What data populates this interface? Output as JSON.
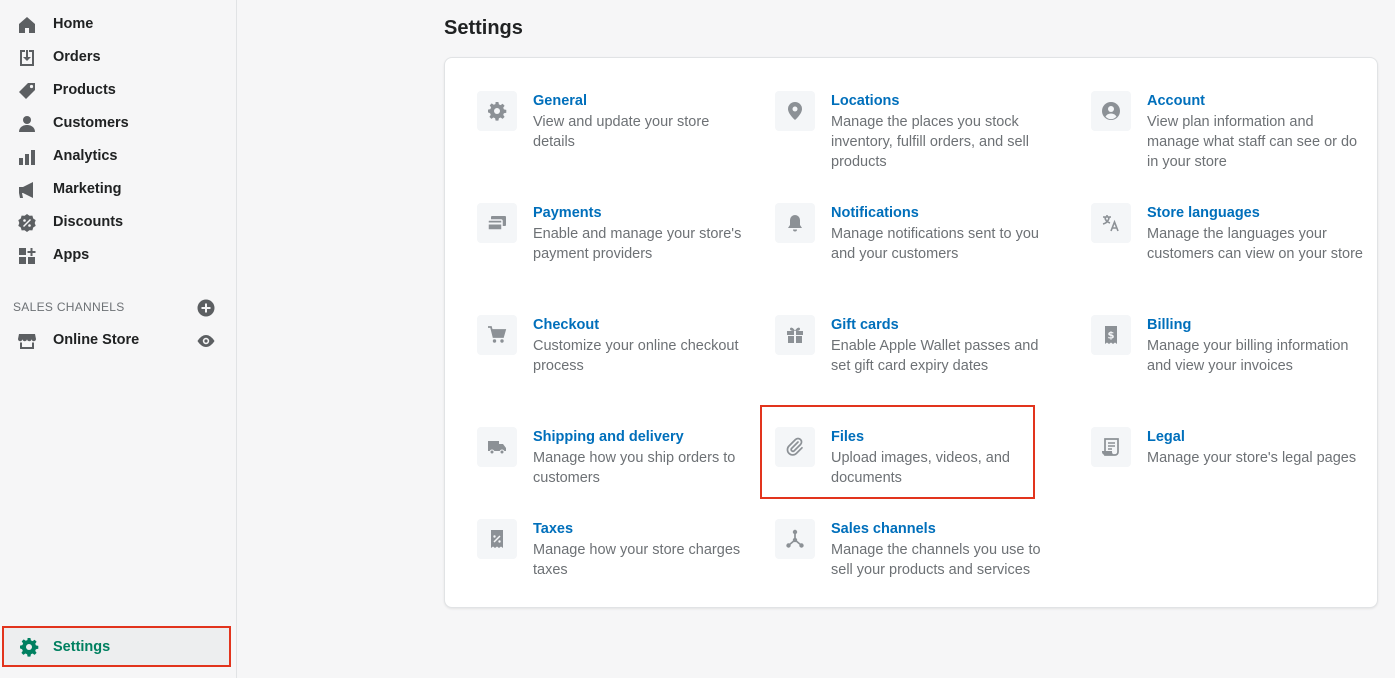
{
  "colors": {
    "accent_green": "#008060",
    "link_blue": "#006fbb",
    "icon_gray": "#5c5f62",
    "tile_icon_gray": "#8c9196",
    "highlight_red": "#e2341d"
  },
  "sidebar": {
    "items": [
      {
        "label": "Home",
        "icon": "home-icon"
      },
      {
        "label": "Orders",
        "icon": "orders-icon"
      },
      {
        "label": "Products",
        "icon": "tag-icon"
      },
      {
        "label": "Customers",
        "icon": "person-icon"
      },
      {
        "label": "Analytics",
        "icon": "bar-chart-icon"
      },
      {
        "label": "Marketing",
        "icon": "megaphone-icon"
      },
      {
        "label": "Discounts",
        "icon": "discount-icon"
      },
      {
        "label": "Apps",
        "icon": "apps-icon"
      }
    ],
    "sales_channels_title": "SALES CHANNELS",
    "online_store_label": "Online Store",
    "settings_label": "Settings"
  },
  "page": {
    "title": "Settings"
  },
  "tiles": [
    {
      "title": "General",
      "desc": "View and update your store details",
      "icon": "gear-icon"
    },
    {
      "title": "Locations",
      "desc": "Manage the places you stock inventory, fulfill orders, and sell products",
      "icon": "location-pin-icon"
    },
    {
      "title": "Account",
      "desc": "View plan information and manage what staff can see or do in your store",
      "icon": "account-circle-icon"
    },
    {
      "title": "Payments",
      "desc": "Enable and manage your store's payment providers",
      "icon": "payment-card-icon"
    },
    {
      "title": "Notifications",
      "desc": "Manage notifications sent to you and your customers",
      "icon": "bell-icon"
    },
    {
      "title": "Store languages",
      "desc": "Manage the languages your customers can view on your store",
      "icon": "translate-icon"
    },
    {
      "title": "Checkout",
      "desc": "Customize your online checkout process",
      "icon": "cart-icon"
    },
    {
      "title": "Gift cards",
      "desc": "Enable Apple Wallet passes and set gift card expiry dates",
      "icon": "gift-icon"
    },
    {
      "title": "Billing",
      "desc": "Manage your billing information and view your invoices",
      "icon": "dollar-receipt-icon"
    },
    {
      "title": "Shipping and delivery",
      "desc": "Manage how you ship orders to customers",
      "icon": "truck-icon"
    },
    {
      "title": "Files",
      "desc": "Upload images, videos, and documents",
      "icon": "paperclip-icon"
    },
    {
      "title": "Legal",
      "desc": "Manage your store's legal pages",
      "icon": "legal-document-icon"
    },
    {
      "title": "Taxes",
      "desc": "Manage how your store charges taxes",
      "icon": "tax-receipt-icon"
    },
    {
      "title": "Sales channels",
      "desc": "Manage the channels you use to sell your products and services",
      "icon": "channels-icon"
    }
  ]
}
